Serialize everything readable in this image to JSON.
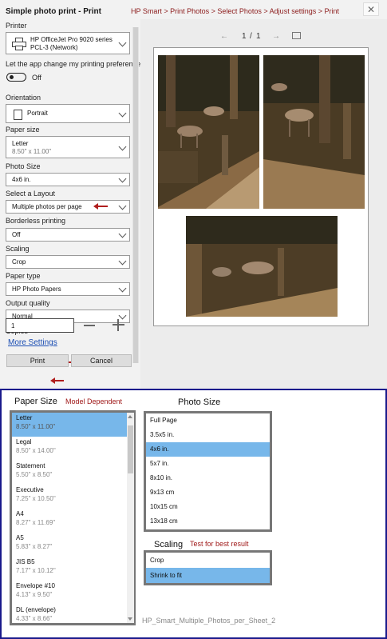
{
  "dialog": {
    "title": "Simple photo print - Print",
    "breadcrumb": "HP Smart > Print Photos > Select Photos > Adjust settings > Print",
    "close_glyph": "✕"
  },
  "settings": {
    "printer": {
      "label": "Printer",
      "name": "HP OfficeJet Pro 9020 series",
      "connection": "PCL-3 (Network)"
    },
    "app_change": {
      "label": "Let the app change my printing preferences",
      "state": "Off"
    },
    "orientation": {
      "label": "Orientation",
      "value": "Portrait"
    },
    "paper_size": {
      "label": "Paper size",
      "value": "Letter",
      "detail": "8.50\" x 11.00\""
    },
    "photo_size": {
      "label": "Photo Size",
      "value": "4x6 in."
    },
    "layout": {
      "label": "Select a Layout",
      "value": "Multiple photos per page"
    },
    "borderless": {
      "label": "Borderless printing",
      "value": "Off"
    },
    "scaling": {
      "label": "Scaling",
      "value": "Crop"
    },
    "paper_type": {
      "label": "Paper type",
      "value": "HP Photo Papers"
    },
    "output_quality": {
      "label": "Output quality",
      "value": "Normal"
    },
    "copies": {
      "label": "Copies",
      "value": "1"
    },
    "more_settings": "More Settings",
    "print_button": "Print",
    "cancel_button": "Cancel"
  },
  "preview": {
    "current_page": "1",
    "separator": "/",
    "total_pages": "1",
    "prev_glyph": "←",
    "next_glyph": "→"
  },
  "paper_size_panel": {
    "title": "Paper Size",
    "note": "Model Dependent",
    "items": [
      {
        "name": "Letter",
        "dim": "8.50\" x 11.00\"",
        "selected": true
      },
      {
        "name": "Legal",
        "dim": "8.50\" x 14.00\""
      },
      {
        "name": "Statement",
        "dim": "5.50\" x 8.50\""
      },
      {
        "name": "Executive",
        "dim": "7.25\" x 10.50\""
      },
      {
        "name": "A4",
        "dim": "8.27\" x 11.69\""
      },
      {
        "name": "A5",
        "dim": "5.83\" x 8.27\""
      },
      {
        "name": "JIS B5",
        "dim": "7.17\" x 10.12\""
      },
      {
        "name": "Envelope #10",
        "dim": "4.13\" x 9.50\""
      },
      {
        "name": "DL (envelope)",
        "dim": "4.33\" x 8.66\""
      }
    ]
  },
  "photo_size_panel": {
    "title": "Photo Size",
    "items": [
      {
        "name": "Full Page"
      },
      {
        "name": "3.5x5 in."
      },
      {
        "name": "4x6 in.",
        "selected": true
      },
      {
        "name": "5x7 in."
      },
      {
        "name": "8x10 in."
      },
      {
        "name": "9x13 cm"
      },
      {
        "name": "10x15 cm"
      },
      {
        "name": "13x18 cm"
      }
    ]
  },
  "scaling_panel": {
    "title": "Scaling",
    "note": "Test for best result",
    "items": [
      {
        "name": "Crop"
      },
      {
        "name": "Shrink to fit",
        "selected": true
      }
    ]
  },
  "footer_label": "HP_Smart_Multiple_Photos_per_Sheet_2",
  "colors": {
    "selection": "#77b7ea",
    "arrow": "#b01e1e",
    "breadcrumb": "#8b1a1a",
    "frame": "#1a1a8c"
  },
  "icons": [
    "printer-icon",
    "orientation-icon",
    "chevron-down-icon",
    "close-icon",
    "fit-page-icon",
    "annotation-arrow"
  ]
}
